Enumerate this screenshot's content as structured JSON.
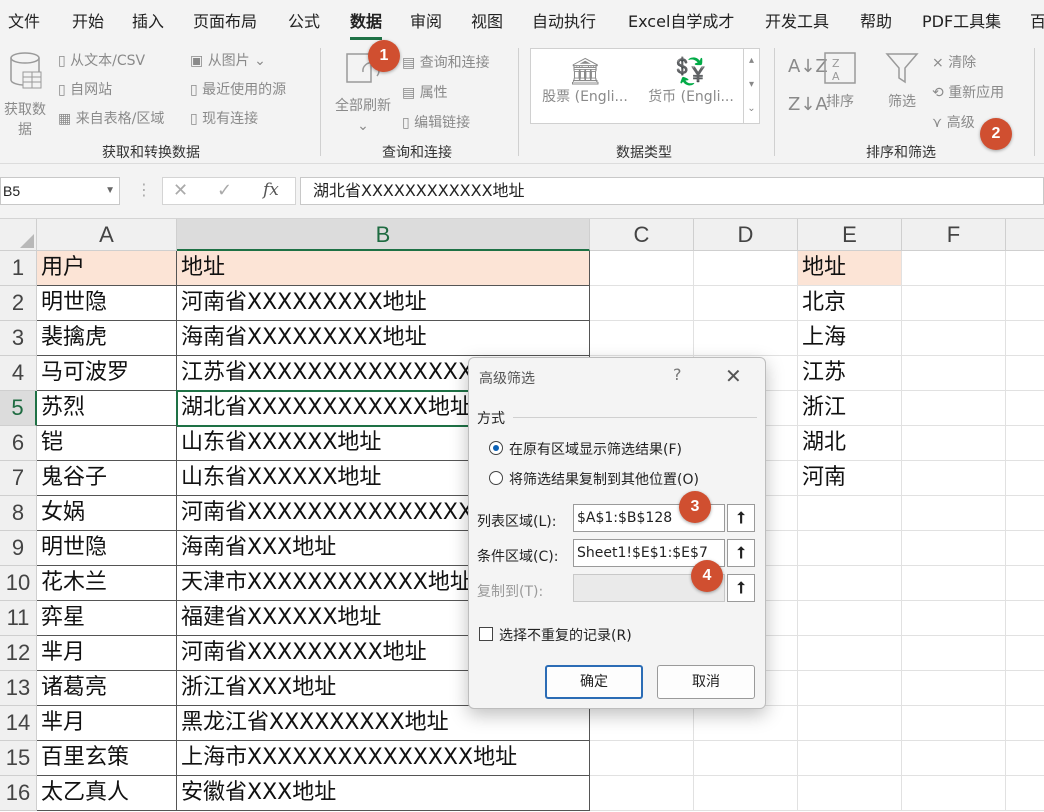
{
  "menu": {
    "tabs": [
      "文件",
      "开始",
      "插入",
      "页面布局",
      "公式",
      "数据",
      "审阅",
      "视图",
      "自动执行",
      "Excel自学成才",
      "开发工具",
      "帮助",
      "PDF工具集",
      "百"
    ],
    "active": "数据"
  },
  "ribbon": {
    "get_transform": {
      "big_label": "获取数据",
      "from_text_csv": "从文本/CSV",
      "from_web": "自网站",
      "from_table": "来自表格/区域",
      "from_picture": "从图片",
      "recent_sources": "最近使用的源",
      "existing_connections": "现有连接",
      "group_label": "获取和转换数据"
    },
    "queries": {
      "refresh_all": "全部刷新",
      "queries_connections": "查询和连接",
      "properties": "属性",
      "edit_links": "编辑链接",
      "group_label": "查询和连接"
    },
    "data_types": {
      "stocks": "股票 (Engli...",
      "currency": "货币 (Engli...",
      "group_label": "数据类型"
    },
    "sort_filter": {
      "sort": "排序",
      "filter": "筛选",
      "clear": "清除",
      "reapply": "重新应用",
      "advanced": "高级",
      "group_label": "排序和筛选"
    },
    "badges": [
      "1",
      "2"
    ]
  },
  "formula_bar": {
    "name_box": "B5",
    "fx": "fx",
    "value": "湖北省XXXXXXXXXXXX地址"
  },
  "sheet": {
    "columns": [
      "A",
      "B",
      "C",
      "D",
      "E",
      "F"
    ],
    "rows": [
      {
        "n": "1",
        "a": "用户",
        "b": "地址",
        "e": "地址"
      },
      {
        "n": "2",
        "a": "明世隐",
        "b": "河南省XXXXXXXXX地址",
        "e": "北京"
      },
      {
        "n": "3",
        "a": "裴擒虎",
        "b": "海南省XXXXXXXXX地址",
        "e": "上海"
      },
      {
        "n": "4",
        "a": "马可波罗",
        "b": "江苏省XXXXXXXXXXXXXXX",
        "e": "江苏"
      },
      {
        "n": "5",
        "a": "苏烈",
        "b": "湖北省XXXXXXXXXXXX地址",
        "e": "浙江"
      },
      {
        "n": "6",
        "a": "铠",
        "b": "山东省XXXXXX地址",
        "e": "湖北"
      },
      {
        "n": "7",
        "a": "鬼谷子",
        "b": "山东省XXXXXX地址",
        "e": "河南"
      },
      {
        "n": "8",
        "a": "女娲",
        "b": "河南省XXXXXXXXXXXXXXX",
        "e": ""
      },
      {
        "n": "9",
        "a": "明世隐",
        "b": "海南省XXX地址",
        "e": ""
      },
      {
        "n": "10",
        "a": "花木兰",
        "b": "天津市XXXXXXXXXXXX地址",
        "e": ""
      },
      {
        "n": "11",
        "a": "弈星",
        "b": "福建省XXXXXX地址",
        "e": ""
      },
      {
        "n": "12",
        "a": "芈月",
        "b": "河南省XXXXXXXXX地址",
        "e": ""
      },
      {
        "n": "13",
        "a": "诸葛亮",
        "b": "浙江省XXX地址",
        "e": ""
      },
      {
        "n": "14",
        "a": "芈月",
        "b": "黑龙江省XXXXXXXXX地址",
        "e": ""
      },
      {
        "n": "15",
        "a": "百里玄策",
        "b": "上海市XXXXXXXXXXXXXXX地址",
        "e": ""
      },
      {
        "n": "16",
        "a": "太乙真人",
        "b": "安徽省XXX地址",
        "e": ""
      }
    ]
  },
  "dialog": {
    "title": "高级筛选",
    "help": "?",
    "close": "✕",
    "section": "方式",
    "option1": "在原有区域显示筛选结果(F)",
    "option2": "将筛选结果复制到其他位置(O)",
    "list_range_label": "列表区域(L):",
    "list_range_value": "$A$1:$B$128",
    "criteria_label": "条件区域(C):",
    "criteria_value": "Sheet1!$E$1:$E$7",
    "copy_to_label": "复制到(T):",
    "copy_to_value": "",
    "unique_label": "选择不重复的记录(R)",
    "ok": "确定",
    "cancel": "取消",
    "badges": [
      "3",
      "4"
    ]
  },
  "colors": {
    "accent": "#1e7145",
    "badge": "#d04f30",
    "header_fill": "#fce4d6"
  }
}
